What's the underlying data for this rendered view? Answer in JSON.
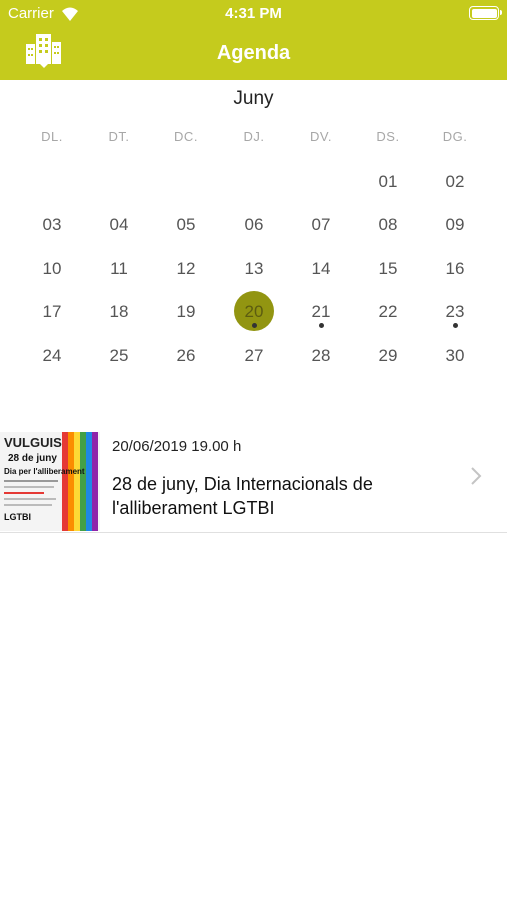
{
  "status_bar": {
    "carrier": "Carrier",
    "time": "4:31 PM"
  },
  "header": {
    "title": "Agenda"
  },
  "calendar": {
    "month": "Juny",
    "weekdays": [
      "DL.",
      "DT.",
      "DC.",
      "DJ.",
      "DV.",
      "DS.",
      "DG."
    ],
    "days": [
      "01",
      "02",
      "03",
      "04",
      "05",
      "06",
      "07",
      "08",
      "09",
      "10",
      "11",
      "12",
      "13",
      "14",
      "15",
      "16",
      "17",
      "18",
      "19",
      "20",
      "21",
      "22",
      "23",
      "24",
      "25",
      "26",
      "27",
      "28",
      "29",
      "30"
    ],
    "first_weekday_index": 5,
    "selected_day": "20",
    "event_days": [
      "20",
      "21",
      "23"
    ]
  },
  "events": [
    {
      "date": "20/06/2019 19.00 h",
      "title": "28 de juny, Dia Internacionals de l'alliberament LGTBI",
      "thumb": {
        "heading": "VULGUIS",
        "subtitle": "28 de juny",
        "line": "Dia per l'alliberament",
        "tag": "LGTBI"
      }
    }
  ],
  "colors": {
    "accent": "#c5cb1d",
    "selected_day": "#929511"
  }
}
